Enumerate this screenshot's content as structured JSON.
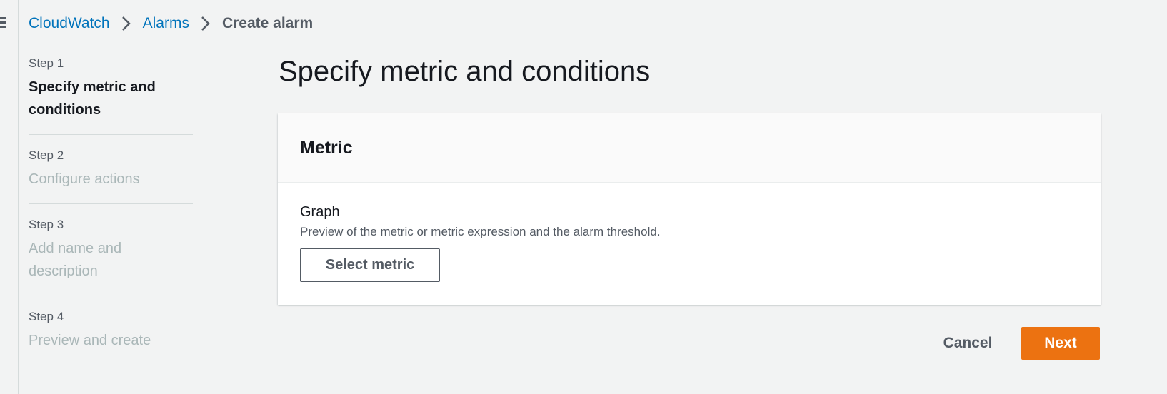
{
  "breadcrumb": {
    "items": [
      {
        "label": "CloudWatch"
      },
      {
        "label": "Alarms"
      },
      {
        "label": "Create alarm"
      }
    ]
  },
  "steps": [
    {
      "number": "Step 1",
      "title": "Specify metric and conditions"
    },
    {
      "number": "Step 2",
      "title": "Configure actions"
    },
    {
      "number": "Step 3",
      "title": "Add name and description"
    },
    {
      "number": "Step 4",
      "title": "Preview and create"
    }
  ],
  "main": {
    "title": "Specify metric and conditions",
    "panel": {
      "header": "Metric",
      "field_label": "Graph",
      "field_description": "Preview of the metric or metric expression and the alarm threshold.",
      "select_button": "Select metric"
    }
  },
  "footer": {
    "cancel_label": "Cancel",
    "next_label": "Next"
  },
  "colors": {
    "link": "#0073bb",
    "primary_button": "#ec7211",
    "background": "#f2f3f3"
  },
  "icons": {
    "menu": "hamburger-menu-icon",
    "separator": "chevron-right-icon"
  }
}
